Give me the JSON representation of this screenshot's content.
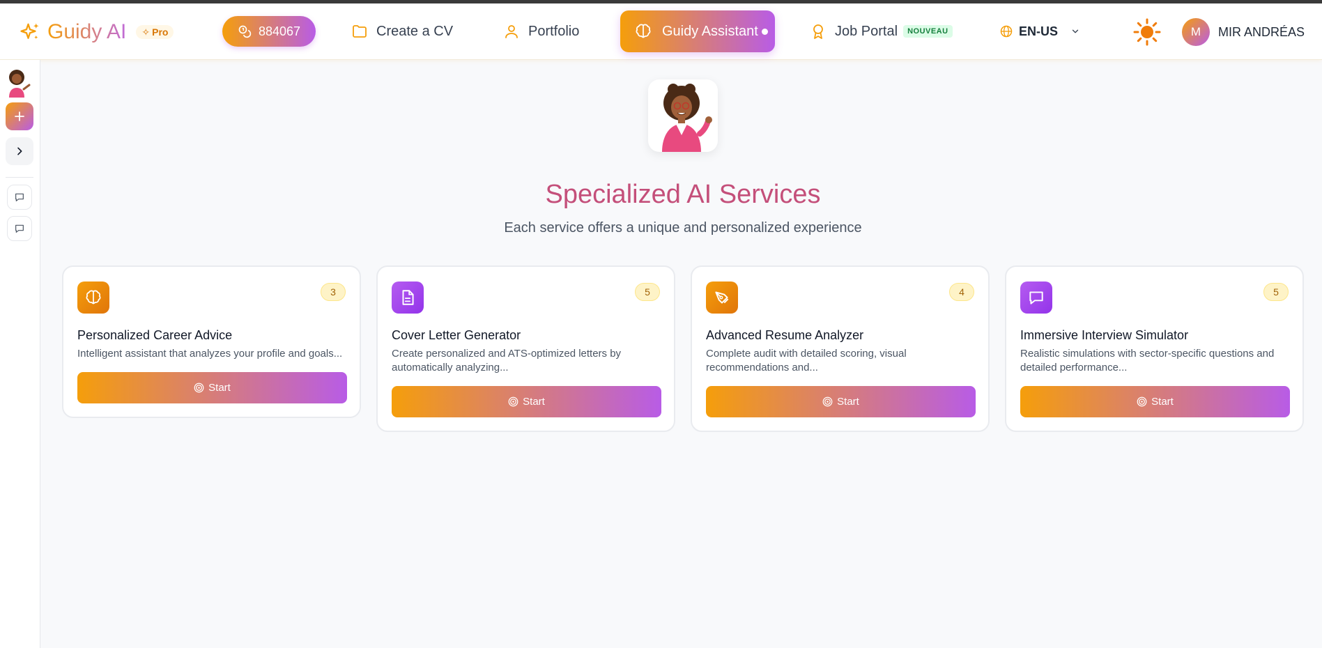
{
  "brand": {
    "name": "Guidy AI",
    "plan_badge": "Pro"
  },
  "header": {
    "credits": "884067",
    "nav": {
      "create_cv": "Create a CV",
      "portfolio": "Portfolio",
      "assistant": "Guidy Assistant",
      "job_portal": "Job Portal",
      "job_portal_badge": "NOUVEAU"
    },
    "language": "EN-US",
    "user": {
      "initial": "M",
      "name": "MIR ANDRÉAS"
    }
  },
  "main": {
    "title": "Specialized AI Services",
    "subtitle": "Each service offers a unique and personalized experience"
  },
  "services": [
    {
      "title": "Personalized Career Advice",
      "description": "Intelligent assistant that analyzes your profile and goals...",
      "count": "3",
      "icon": "brain-icon",
      "button": "Start"
    },
    {
      "title": "Cover Letter Generator",
      "description": "Create personalized and ATS-optimized letters by automatically analyzing...",
      "count": "5",
      "icon": "document-icon",
      "button": "Start"
    },
    {
      "title": "Advanced Resume Analyzer",
      "description": "Complete audit with detailed scoring, visual recommendations and...",
      "count": "4",
      "icon": "pen-tool-icon",
      "button": "Start"
    },
    {
      "title": "Immersive Interview Simulator",
      "description": "Realistic simulations with sector-specific questions and detailed performance...",
      "count": "5",
      "icon": "chat-icon",
      "button": "Start"
    }
  ],
  "colors": {
    "accent_orange": "#f59e0b",
    "accent_purple": "#b85ce6",
    "title_pink": "#c44f7a"
  }
}
